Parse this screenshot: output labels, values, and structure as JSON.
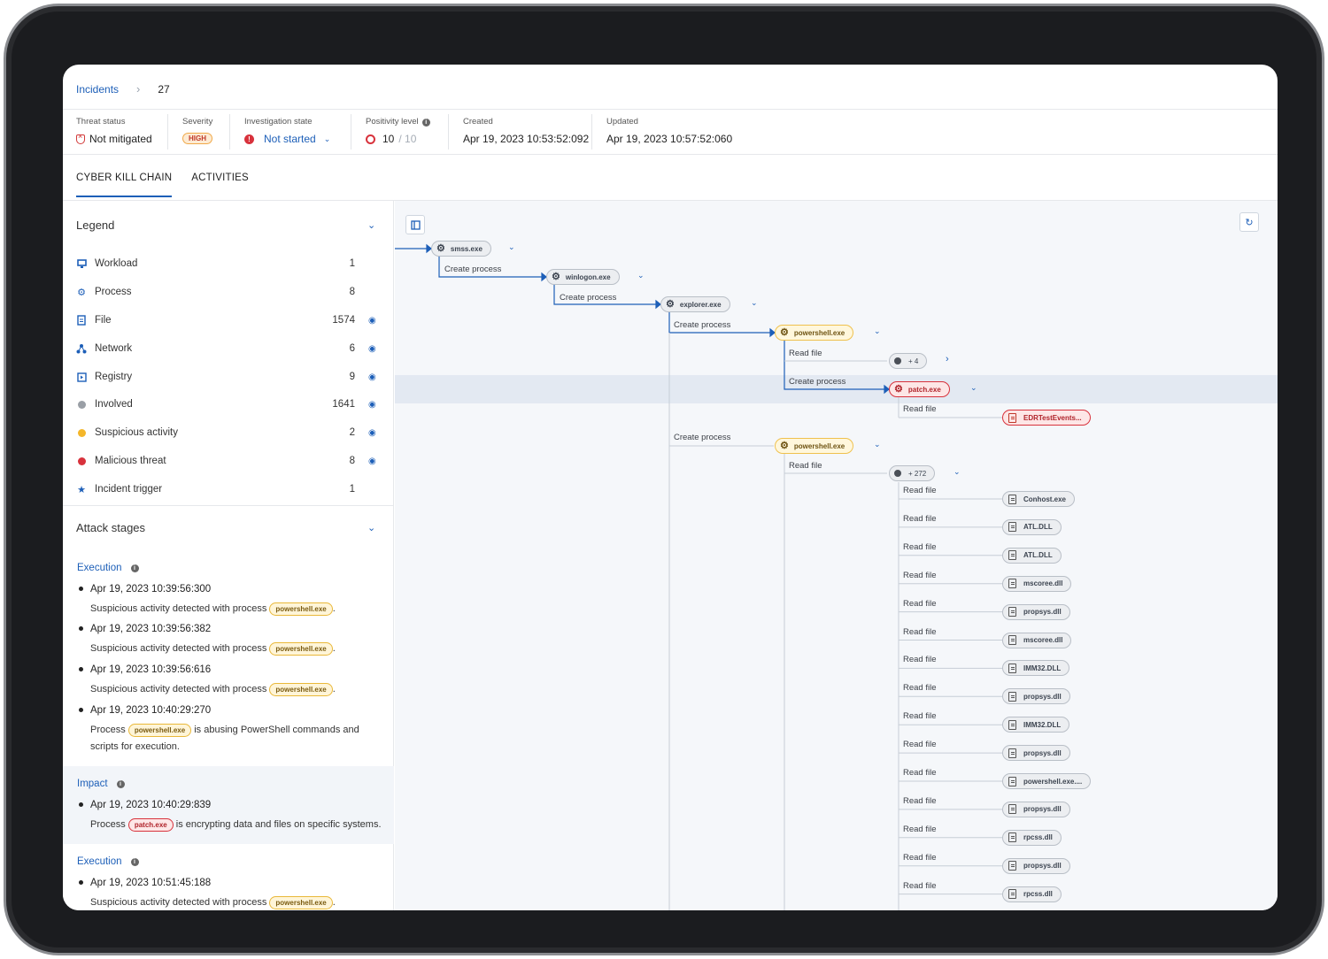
{
  "breadcrumb": {
    "parent": "Incidents",
    "separator": "›",
    "current": "27"
  },
  "meta": {
    "threat_status": {
      "label": "Threat status",
      "value": "Not mitigated"
    },
    "severity": {
      "label": "Severity",
      "value": "HIGH"
    },
    "investigation": {
      "label": "Investigation state",
      "value": "Not started",
      "icon": "!"
    },
    "positivity": {
      "label": "Positivity level",
      "value": "10",
      "total": "/ 10"
    },
    "created": {
      "label": "Created",
      "value": "Apr 19, 2023 10:53:52:092"
    },
    "updated": {
      "label": "Updated",
      "value": "Apr 19, 2023 10:57:52:060"
    }
  },
  "tabs": [
    {
      "label": "CYBER KILL CHAIN",
      "active": true
    },
    {
      "label": "ACTIVITIES",
      "active": false
    }
  ],
  "legend": {
    "title": "Legend",
    "items": [
      {
        "label": "Workload",
        "count": "1",
        "icon": "monitor-icon"
      },
      {
        "label": "Process",
        "count": "8",
        "icon": "gear-icon"
      },
      {
        "label": "File",
        "count": "1574",
        "icon": "file-icon"
      },
      {
        "label": "Network",
        "count": "6",
        "icon": "network-icon"
      },
      {
        "label": "Registry",
        "count": "9",
        "icon": "registry-icon"
      },
      {
        "label": "Involved",
        "count": "1641",
        "icon": "gray-dot",
        "color": "#9a9fa6"
      },
      {
        "label": "Suspicious activity",
        "count": "2",
        "icon": "yellow-dot",
        "color": "#f4b62a"
      },
      {
        "label": "Malicious threat",
        "count": "8",
        "icon": "red-dot",
        "color": "#d8323c"
      },
      {
        "label": "Incident trigger",
        "count": "1",
        "icon": "star-icon"
      }
    ]
  },
  "attack_stages": {
    "title": "Attack stages",
    "stages": [
      {
        "name": "Execution",
        "events": [
          {
            "time": "Apr 19, 2023 10:39:56:300",
            "pre": "Suspicious activity detected with process",
            "pill": "powershell.exe",
            "post": "."
          },
          {
            "time": "Apr 19, 2023 10:39:56:382",
            "pre": "Suspicious activity detected with process",
            "pill": "powershell.exe",
            "post": "."
          },
          {
            "time": "Apr 19, 2023 10:39:56:616",
            "pre": "Suspicious activity detected with process",
            "pill": "powershell.exe",
            "post": "."
          },
          {
            "time": "Apr 19, 2023 10:40:29:270",
            "pre": "Process",
            "pill": "powershell.exe",
            "post": "is abusing PowerShell commands and scripts for execution."
          }
        ]
      },
      {
        "name": "Impact",
        "events": [
          {
            "time": "Apr 19, 2023 10:40:29:839",
            "pre": "Process",
            "pill": "patch.exe",
            "post": "is encrypting data and files on specific systems."
          }
        ]
      },
      {
        "name": "Execution",
        "events": [
          {
            "time": "Apr 19, 2023 10:51:45:188",
            "pre": "Suspicious activity detected with process",
            "pill": "powershell.exe",
            "post": "."
          }
        ]
      }
    ]
  },
  "graph": {
    "processes": [
      "smss.exe",
      "winlogon.exe",
      "explorer.exe",
      "powershell.exe",
      "patch.exe",
      "powershell.exe"
    ],
    "edge_labels": {
      "create": "Create process",
      "read": "Read file"
    },
    "collapsed_a": "+ 4",
    "collapsed_b": "+ 272",
    "trigger_file": "EDRTestEvents...",
    "files": [
      "Conhost.exe",
      "ATL.DLL",
      "ATL.DLL",
      "mscoree.dll",
      "propsys.dll",
      "mscoree.dll",
      "IMM32.DLL",
      "propsys.dll",
      "IMM32.DLL",
      "propsys.dll",
      "powershell.exe....",
      "propsys.dll",
      "rpcss.dll",
      "propsys.dll",
      "rpcss.dll"
    ]
  }
}
